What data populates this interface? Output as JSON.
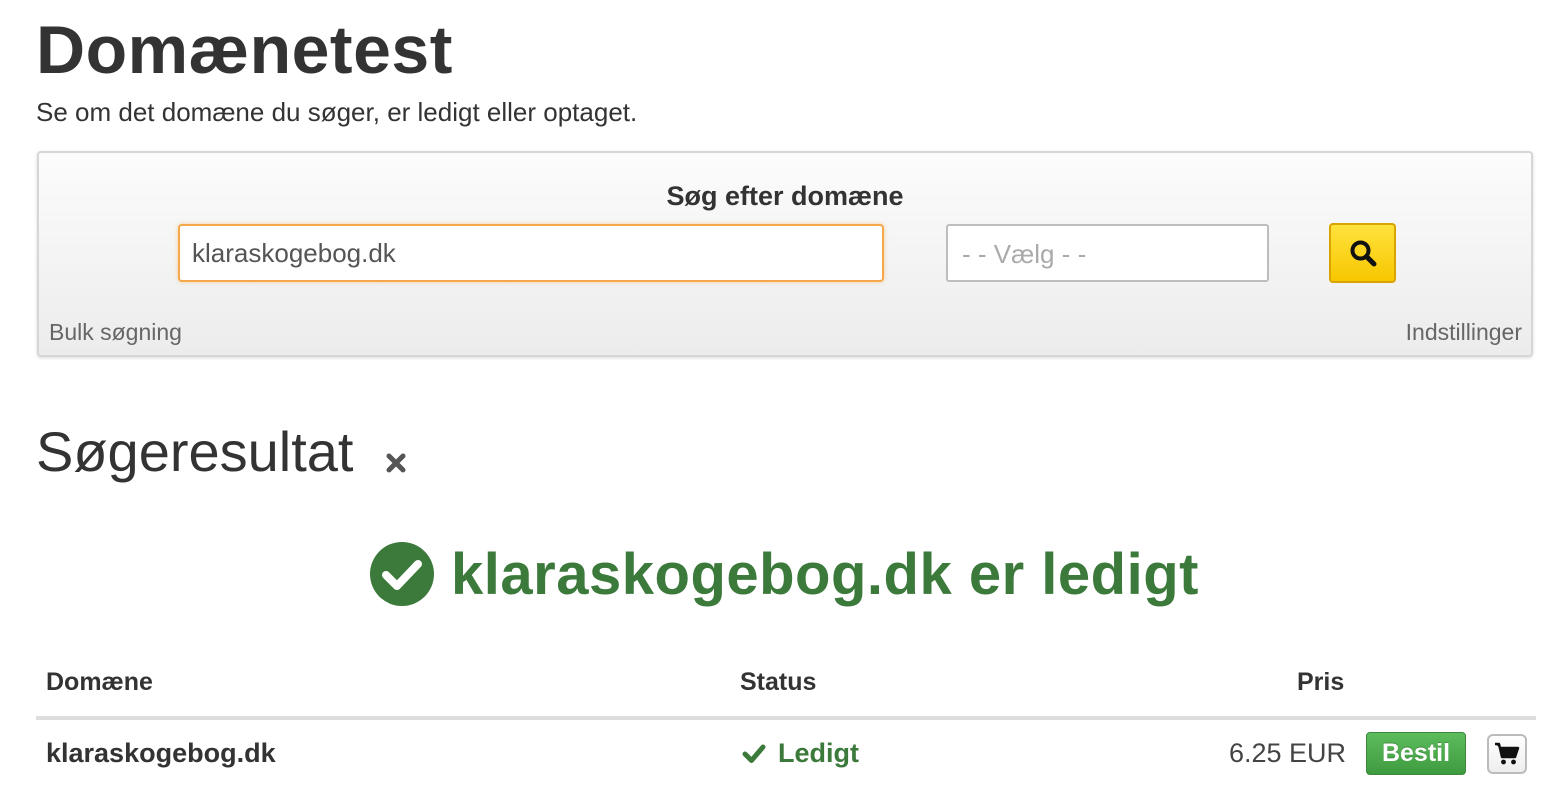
{
  "header": {
    "title": "Domænetest",
    "subtitle": "Se om det domæne du søger, er ledigt eller optaget."
  },
  "search": {
    "heading": "Søg efter domæne",
    "query_value": "klaraskogebog.dk",
    "tld_select_value": "- - Vælg - -",
    "search_button_icon": "search-icon",
    "bulk_link": "Bulk søgning",
    "settings_link": "Indstillinger",
    "accent_color": "#f7c700"
  },
  "results": {
    "heading": "Søgeresultat",
    "close_icon": "close-icon",
    "banner_text": "klaraskogebog.dk er ledigt",
    "banner_icon": "check-circle-icon",
    "success_color": "#3b7a3b",
    "table": {
      "columns": [
        "Domæne",
        "Status",
        "Pris"
      ],
      "rows": [
        {
          "domain": "klaraskogebog.dk",
          "status": "Ledigt",
          "status_icon": "checkmark-icon",
          "price": "6.25 EUR",
          "order_label": "Bestil",
          "cart_icon": "cart-icon"
        }
      ]
    }
  }
}
